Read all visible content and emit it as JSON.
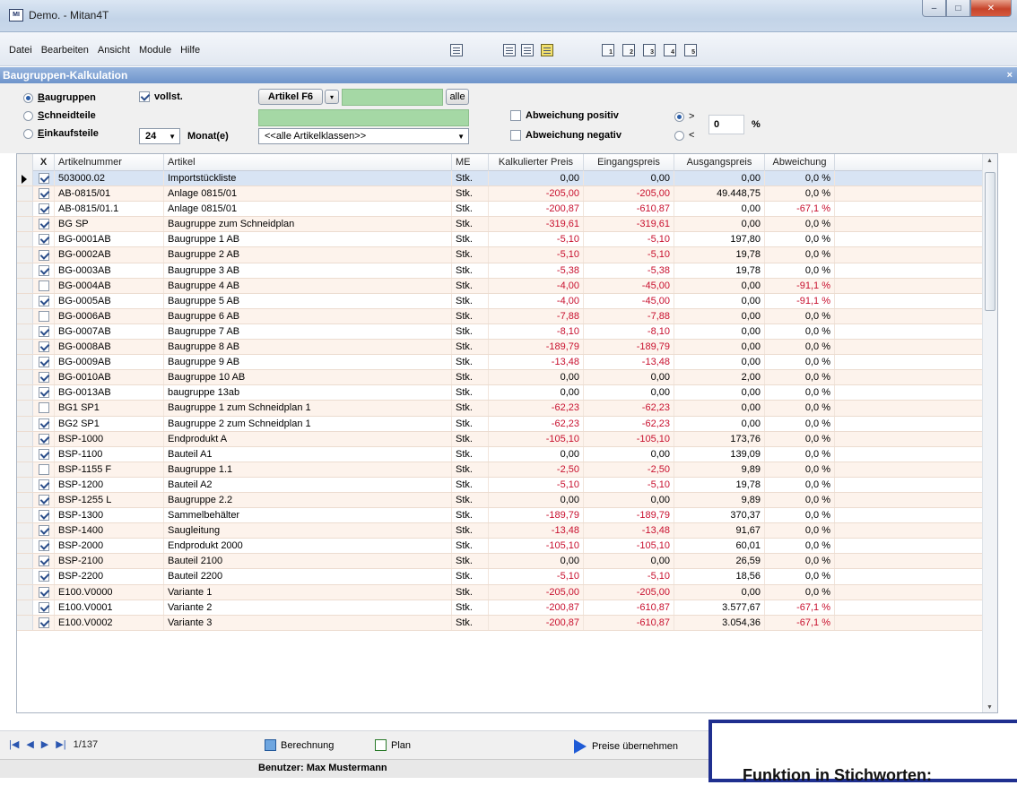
{
  "window": {
    "app_icon": "MI",
    "title": "Demo. - Mitan4T",
    "controls": [
      "–",
      "□",
      "✕"
    ]
  },
  "menu": [
    "Datei",
    "Bearbeiten",
    "Ansicht",
    "Module",
    "Hilfe"
  ],
  "toolbar_icons": [
    "list-icon",
    "table-icon",
    "table-icon-2",
    "image-icon",
    "form-1-icon",
    "form-2-icon",
    "form-3-icon",
    "form-4-icon",
    "form-5-icon"
  ],
  "panel": {
    "title": "Baugruppen-Kalkulation",
    "close": "×"
  },
  "filters": {
    "radio_baugruppen": "Baugruppen",
    "radio_schneidteile": "Schneidteile",
    "radio_einkaufsteile": "Einkaufsteile",
    "vollst": "vollst.",
    "artikel_button": "Artikel F6",
    "alle_button": "alle",
    "months_value": "24",
    "months_label": "Monat(e)",
    "artikelklassen": "<<alle Artikelklassen>>",
    "abweichung_positiv": "Abweichung positiv",
    "abweichung_negativ": "Abweichung negativ",
    "gt": ">",
    "lt": "<",
    "threshold": "0",
    "percent": "%"
  },
  "columns": [
    "X",
    "Artikelnummer",
    "Artikel",
    "ME",
    "Kalkulierter Preis",
    "Eingangspreis",
    "Ausgangspreis",
    "Abweichung"
  ],
  "rows": [
    {
      "checked": true,
      "num": "503000.02",
      "art": "Importstückliste",
      "me": "Stk.",
      "kp": "0,00",
      "ep": "0,00",
      "ap": "0,00",
      "ab": "0,0 %"
    },
    {
      "checked": true,
      "num": "AB-0815/01",
      "art": "Anlage 0815/01",
      "me": "Stk.",
      "kp": "-205,00",
      "ep": "-205,00",
      "ap": "49.448,75",
      "ab": "0,0 %"
    },
    {
      "checked": true,
      "num": "AB-0815/01.1",
      "art": "Anlage 0815/01",
      "me": "Stk.",
      "kp": "-200,87",
      "ep": "-610,87",
      "ap": "0,00",
      "ab": "-67,1 %"
    },
    {
      "checked": true,
      "num": "BG SP",
      "art": "Baugruppe zum Schneidplan",
      "me": "Stk.",
      "kp": "-319,61",
      "ep": "-319,61",
      "ap": "0,00",
      "ab": "0,0 %"
    },
    {
      "checked": true,
      "num": "BG-0001AB",
      "art": "Baugruppe 1 AB",
      "me": "Stk.",
      "kp": "-5,10",
      "ep": "-5,10",
      "ap": "197,80",
      "ab": "0,0 %"
    },
    {
      "checked": true,
      "num": "BG-0002AB",
      "art": "Baugruppe 2 AB",
      "me": "Stk.",
      "kp": "-5,10",
      "ep": "-5,10",
      "ap": "19,78",
      "ab": "0,0 %"
    },
    {
      "checked": true,
      "num": "BG-0003AB",
      "art": "Baugruppe 3 AB",
      "me": "Stk.",
      "kp": "-5,38",
      "ep": "-5,38",
      "ap": "19,78",
      "ab": "0,0 %"
    },
    {
      "checked": false,
      "num": "BG-0004AB",
      "art": "Baugruppe 4 AB",
      "me": "Stk.",
      "kp": "-4,00",
      "ep": "-45,00",
      "ap": "0,00",
      "ab": "-91,1 %"
    },
    {
      "checked": true,
      "num": "BG-0005AB",
      "art": "Baugruppe 5 AB",
      "me": "Stk.",
      "kp": "-4,00",
      "ep": "-45,00",
      "ap": "0,00",
      "ab": "-91,1 %"
    },
    {
      "checked": false,
      "num": "BG-0006AB",
      "art": "Baugruppe 6 AB",
      "me": "Stk.",
      "kp": "-7,88",
      "ep": "-7,88",
      "ap": "0,00",
      "ab": "0,0 %"
    },
    {
      "checked": true,
      "num": "BG-0007AB",
      "art": "Baugruppe 7 AB",
      "me": "Stk.",
      "kp": "-8,10",
      "ep": "-8,10",
      "ap": "0,00",
      "ab": "0,0 %"
    },
    {
      "checked": true,
      "num": "BG-0008AB",
      "art": "Baugruppe 8 AB",
      "me": "Stk.",
      "kp": "-189,79",
      "ep": "-189,79",
      "ap": "0,00",
      "ab": "0,0 %"
    },
    {
      "checked": true,
      "num": "BG-0009AB",
      "art": "Baugruppe 9 AB",
      "me": "Stk.",
      "kp": "-13,48",
      "ep": "-13,48",
      "ap": "0,00",
      "ab": "0,0 %"
    },
    {
      "checked": true,
      "num": "BG-0010AB",
      "art": "Baugruppe 10 AB",
      "me": "Stk.",
      "kp": "0,00",
      "ep": "0,00",
      "ap": "2,00",
      "ab": "0,0 %"
    },
    {
      "checked": true,
      "num": "BG-0013AB",
      "art": "baugruppe 13ab",
      "me": "Stk.",
      "kp": "0,00",
      "ep": "0,00",
      "ap": "0,00",
      "ab": "0,0 %"
    },
    {
      "checked": false,
      "num": "BG1 SP1",
      "art": "Baugruppe 1 zum Schneidplan 1",
      "me": "Stk.",
      "kp": "-62,23",
      "ep": "-62,23",
      "ap": "0,00",
      "ab": "0,0 %"
    },
    {
      "checked": true,
      "num": "BG2 SP1",
      "art": "Baugruppe 2 zum Schneidplan 1",
      "me": "Stk.",
      "kp": "-62,23",
      "ep": "-62,23",
      "ap": "0,00",
      "ab": "0,0 %"
    },
    {
      "checked": true,
      "num": "BSP-1000",
      "art": "Endprodukt A",
      "me": "Stk.",
      "kp": "-105,10",
      "ep": "-105,10",
      "ap": "173,76",
      "ab": "0,0 %"
    },
    {
      "checked": true,
      "num": "BSP-1100",
      "art": "Bauteil A1",
      "me": "Stk.",
      "kp": "0,00",
      "ep": "0,00",
      "ap": "139,09",
      "ab": "0,0 %"
    },
    {
      "checked": false,
      "num": "BSP-1155 F",
      "art": "Baugruppe 1.1",
      "me": "Stk.",
      "kp": "-2,50",
      "ep": "-2,50",
      "ap": "9,89",
      "ab": "0,0 %"
    },
    {
      "checked": true,
      "num": "BSP-1200",
      "art": "Bauteil A2",
      "me": "Stk.",
      "kp": "-5,10",
      "ep": "-5,10",
      "ap": "19,78",
      "ab": "0,0 %"
    },
    {
      "checked": true,
      "num": "BSP-1255 L",
      "art": "Baugruppe 2.2",
      "me": "Stk.",
      "kp": "0,00",
      "ep": "0,00",
      "ap": "9,89",
      "ab": "0,0 %"
    },
    {
      "checked": true,
      "num": "BSP-1300",
      "art": "Sammelbehälter",
      "me": "Stk.",
      "kp": "-189,79",
      "ep": "-189,79",
      "ap": "370,37",
      "ab": "0,0 %"
    },
    {
      "checked": true,
      "num": "BSP-1400",
      "art": "Saugleitung",
      "me": "Stk.",
      "kp": "-13,48",
      "ep": "-13,48",
      "ap": "91,67",
      "ab": "0,0 %"
    },
    {
      "checked": true,
      "num": "BSP-2000",
      "art": "Endprodukt 2000",
      "me": "Stk.",
      "kp": "-105,10",
      "ep": "-105,10",
      "ap": "60,01",
      "ab": "0,0 %"
    },
    {
      "checked": true,
      "num": "BSP-2100",
      "art": "Bauteil 2100",
      "me": "Stk.",
      "kp": "0,00",
      "ep": "0,00",
      "ap": "26,59",
      "ab": "0,0 %"
    },
    {
      "checked": true,
      "num": "BSP-2200",
      "art": "Bauteil 2200",
      "me": "Stk.",
      "kp": "-5,10",
      "ep": "-5,10",
      "ap": "18,56",
      "ab": "0,0 %"
    },
    {
      "checked": true,
      "num": "E100.V0000",
      "art": "Variante 1",
      "me": "Stk.",
      "kp": "-205,00",
      "ep": "-205,00",
      "ap": "0,00",
      "ab": "0,0 %"
    },
    {
      "checked": true,
      "num": "E100.V0001",
      "art": "Variante 2",
      "me": "Stk.",
      "kp": "-200,87",
      "ep": "-610,87",
      "ap": "3.577,67",
      "ab": "-67,1 %"
    },
    {
      "checked": true,
      "num": "E100.V0002",
      "art": "Variante 3",
      "me": "Stk.",
      "kp": "-200,87",
      "ep": "-610,87",
      "ap": "3.054,36",
      "ab": "-67,1 %"
    }
  ],
  "navigation": {
    "record": "1/137"
  },
  "bottom": {
    "berechnung": "Berechnung",
    "plan": "Plan",
    "preise": "Preise übernehmen"
  },
  "status": {
    "user": "Benutzer: Max Mustermann"
  },
  "overlay": {
    "text": "Funktion in Stichworten:"
  }
}
